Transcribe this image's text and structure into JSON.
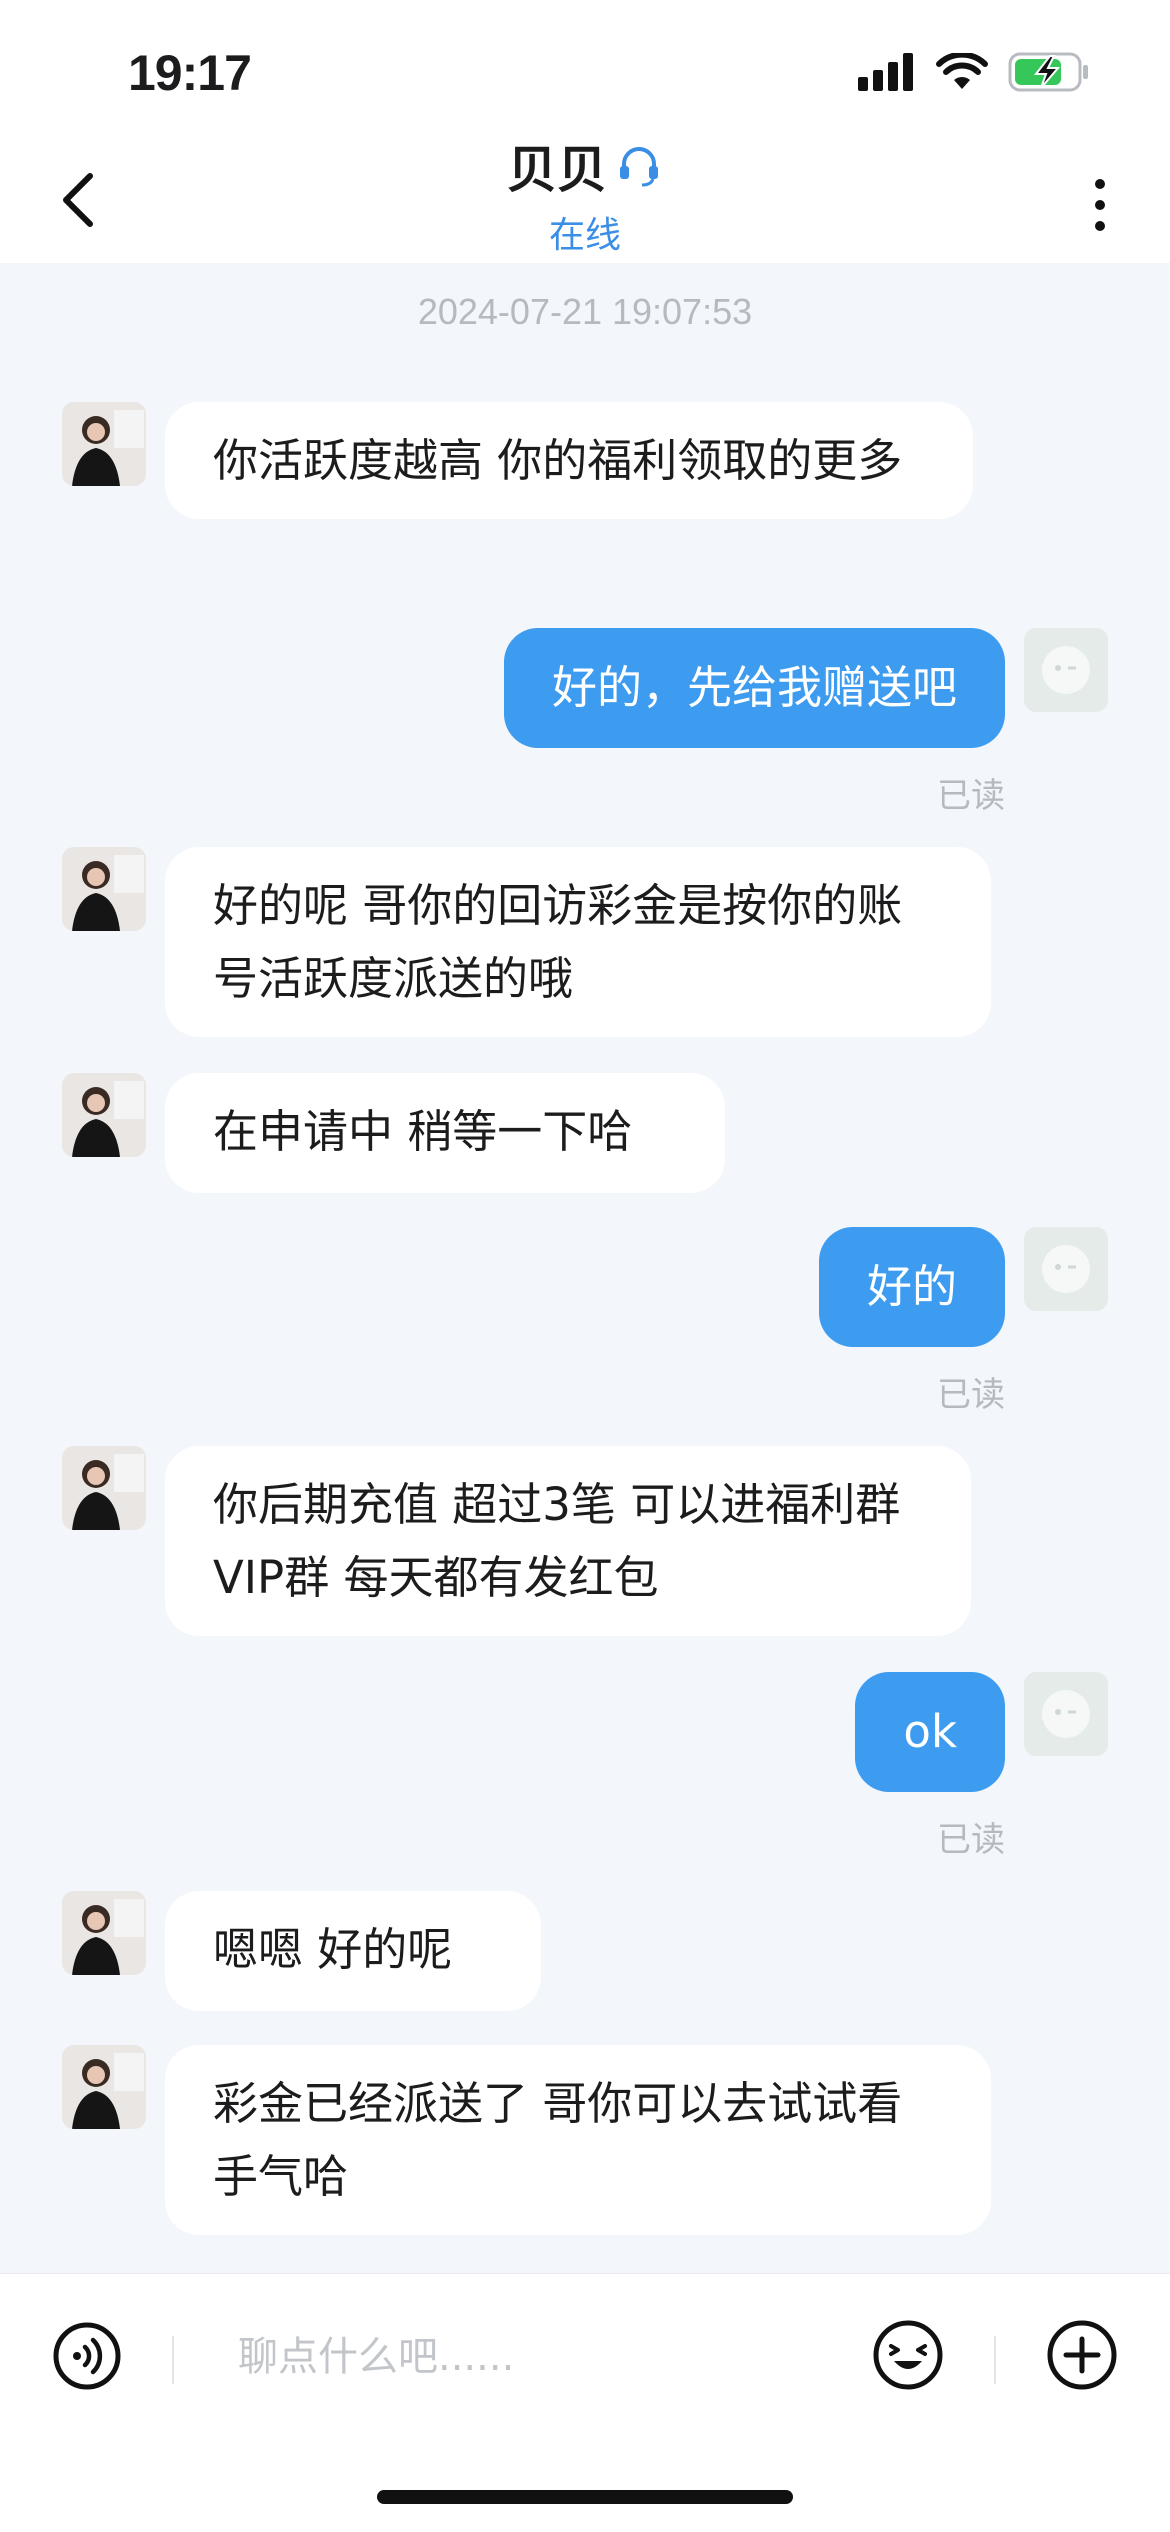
{
  "status_bar": {
    "time": "19:17"
  },
  "header": {
    "title": "贝贝",
    "status": "在线"
  },
  "chat": {
    "timestamp": "2024-07-21 19:07:53",
    "read_label": "已读",
    "messages": [
      {
        "from": "other",
        "text": "你活跃度越高 你的福利领取的更多"
      },
      {
        "from": "me",
        "text": "好的，先给我赠送吧"
      },
      {
        "from": "other",
        "text": "好的呢  哥你的回访彩金是按你的账号活跃度派送的哦"
      },
      {
        "from": "other",
        "text": "在申请中 稍等一下哈"
      },
      {
        "from": "me",
        "text": "好的"
      },
      {
        "from": "other",
        "text": "你后期充值 超过3笔 可以进福利群  VIP群  每天都有发红包"
      },
      {
        "from": "me",
        "text": "ok"
      },
      {
        "from": "other",
        "text": "嗯嗯 好的呢"
      },
      {
        "from": "other",
        "text": "彩金已经派送了  哥你可以去试试看手气哈"
      }
    ]
  },
  "input": {
    "placeholder": "聊点什么吧......"
  },
  "icons": {
    "back": "chevron-left-icon",
    "service": "headset-icon",
    "more": "more-vertical-icon",
    "voice": "voice-icon",
    "emoji": "emoji-icon",
    "plus": "plus-circle-icon"
  },
  "colors": {
    "accent": "#3d9cf0",
    "status_text": "#3a8ee6",
    "background": "#f3f6fa",
    "battery": "#35c759"
  }
}
